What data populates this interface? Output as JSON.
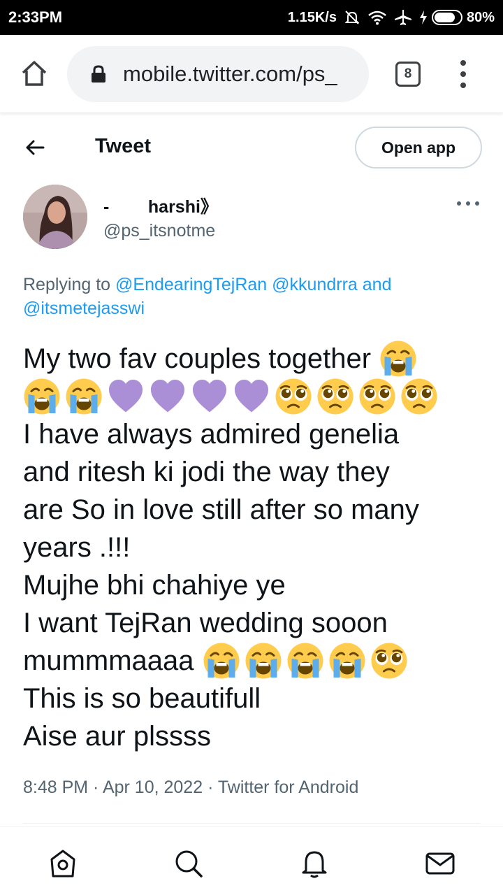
{
  "status_bar": {
    "time": "2:33PM",
    "network_speed": "1.15K/s",
    "battery_percent": "80%",
    "battery_level": 0.8
  },
  "browser": {
    "url": "mobile.twitter.com/ps_",
    "tab_count": "8"
  },
  "header": {
    "title": "Tweet",
    "open_app_label": "Open app"
  },
  "author": {
    "display_name": "-        harshi》",
    "handle": "@ps_itsnotme"
  },
  "reply": {
    "prefix": "Replying to ",
    "mention_1": "@EndearingTejRan",
    "mention_2": "@kkundrra",
    "conjunction": " and",
    "mention_3": "@itsmetejasswi"
  },
  "tweet": {
    "line_1": "My two fav couples together",
    "line_3": "I have always admired genelia",
    "line_4": "and ritesh ki jodi the way they",
    "line_5": "are So in love still after so many",
    "line_6": "years .!!!",
    "line_7": "Mujhe bhi chahiye ye",
    "line_8": "I want TejRan wedding sooon",
    "line_9": "mummmaaaa",
    "line_10": "This is so beautifull",
    "line_11": "Aise aur plssss",
    "emojis": [
      "loudly-crying-face",
      "purple-heart",
      "pleading-face"
    ]
  },
  "meta": {
    "time": "8:48 PM",
    "date": "Apr 10, 2022",
    "source": "Twitter for Android",
    "separator": " · "
  },
  "colors": {
    "accent": "#1d9bf0",
    "secondary_text": "#536471",
    "primary_text": "#0f1419",
    "heart": "#aa8ed6",
    "emoji_yellow": "#ffcc4d"
  }
}
